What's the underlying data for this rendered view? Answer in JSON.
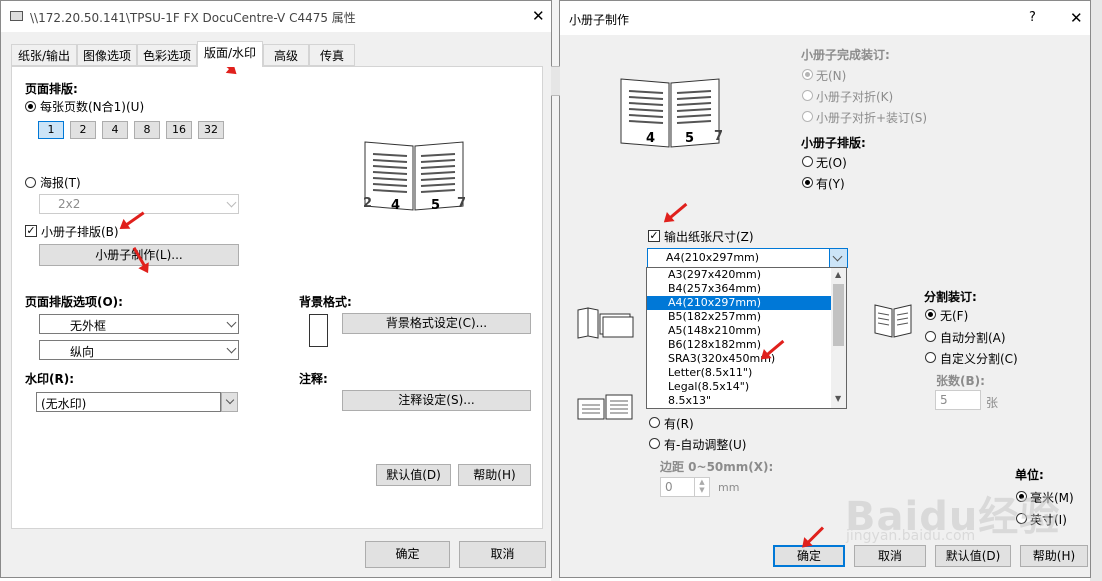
{
  "left_window": {
    "title": "\\\\172.20.50.141\\TPSU-1F FX DocuCentre-V C4475 属性",
    "close": "✕",
    "tabs": [
      "纸张/输出",
      "图像选项",
      "色彩选项",
      "版面/水印",
      "高级",
      "传真"
    ],
    "selected_tab": "版面/水印",
    "page_layout_heading": "页面排版:",
    "pages_per_sheet_label": "每张页数(N合1)(U)",
    "pages_options": [
      "1",
      "2",
      "4",
      "8",
      "16",
      "32"
    ],
    "selected_pages": "1",
    "poster_label": "海报(T)",
    "poster_value": "2x2",
    "booklet_label": "小册子排版(B)",
    "booklet_button": "小册子制作(L)...",
    "layout_options_heading": "页面排版选项(O):",
    "border_value": "无外框",
    "orientation_value": "纵向",
    "watermark_heading": "水印(R):",
    "watermark_value": "(无水印)",
    "background_heading": "背景格式:",
    "background_button": "背景格式设定(C)...",
    "annotation_heading": "注释:",
    "annotation_button": "注释设定(S)...",
    "default_button": "默认值(D)",
    "help_button": "帮助(H)",
    "ok_button": "确定",
    "cancel_button": "取消",
    "preview_pages": [
      "2",
      "4",
      "5",
      "7"
    ]
  },
  "right_window": {
    "title": "小册子制作",
    "help": "?",
    "close": "✕",
    "binding_heading": "小册子完成装订:",
    "binding_options": [
      "无(N)",
      "小册子对折(K)",
      "小册子对折+装订(S)"
    ],
    "layout_heading": "小册子排版:",
    "layout_options": [
      "无(O)",
      "有(Y)"
    ],
    "output_size_label": "输出纸张尺寸(Z)",
    "output_size_value": "A4(210x297mm)",
    "size_options": [
      "A3(297x420mm)",
      "B4(257x364mm)",
      "A4(210x297mm)",
      "B5(182x257mm)",
      "A5(148x210mm)",
      "B6(128x182mm)",
      "SRA3(320x450mm)",
      "Letter(8.5x11\")",
      "Legal(8.5x14\")",
      "8.5x13\""
    ],
    "selected_size": "A4(210x297mm)",
    "split_heading": "分割装订:",
    "split_options": [
      "无(F)",
      "自动分割(A)",
      "自定义分割(C)"
    ],
    "sheets_label": "张数(B):",
    "sheets_value": "5",
    "sheets_unit": "张",
    "gutter_options": [
      "有(R)",
      "有-自动调整(U)"
    ],
    "margin_label": "边距 0~50mm(X):",
    "margin_value": "0",
    "margin_unit": "mm",
    "unit_heading": "单位:",
    "unit_options": [
      "毫米(M)",
      "英寸(I)"
    ],
    "ok_button": "确定",
    "cancel_button": "取消",
    "default_button": "默认值(D)",
    "help_button": "帮助(H)",
    "preview_pages": [
      "4",
      "5",
      "7"
    ]
  },
  "watermark_text": "Baidu经验",
  "watermark_sub": "jingyan.baidu.com",
  "accent_color": "#0078d7",
  "arrow_color": "#e0201c"
}
